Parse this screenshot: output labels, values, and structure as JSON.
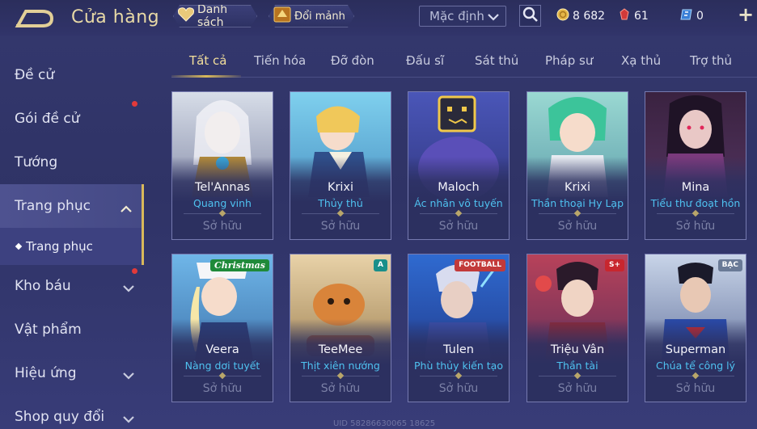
{
  "header": {
    "title": "Cửa hàng",
    "list_label": "Danh sách",
    "shards_label": "Đổi mảnh",
    "sort_value": "Mặc định"
  },
  "currencies": {
    "gold": "8 682",
    "ruby": "61",
    "voucher": "0"
  },
  "sidebar": {
    "items": [
      {
        "label": "Đề cử"
      },
      {
        "label": "Gói đề cử"
      },
      {
        "label": "Tướng"
      },
      {
        "label": "Trang phục"
      },
      {
        "label": "Trang phục"
      },
      {
        "label": "Kho báu"
      },
      {
        "label": "Vật phẩm"
      },
      {
        "label": "Hiệu ứng"
      },
      {
        "label": "Shop quy đổi"
      }
    ]
  },
  "tabs": [
    {
      "label": "Tất cả"
    },
    {
      "label": "Tiến hóa"
    },
    {
      "label": "Đỡ đòn"
    },
    {
      "label": "Đấu sĩ"
    },
    {
      "label": "Sát thủ"
    },
    {
      "label": "Pháp sư"
    },
    {
      "label": "Xạ thủ"
    },
    {
      "label": "Trợ thủ"
    }
  ],
  "owned_label": "Sở hữu",
  "cards": [
    {
      "hero": "Tel'Annas",
      "skin": "Quang vinh"
    },
    {
      "hero": "Krixi",
      "skin": "Thủy thủ"
    },
    {
      "hero": "Maloch",
      "skin": "Ác nhân vô tuyến"
    },
    {
      "hero": "Krixi",
      "skin": "Thần thoại Hy Lạp"
    },
    {
      "hero": "Mina",
      "skin": "Tiểu thư đoạt hồn"
    },
    {
      "hero": "Veera",
      "skin": "Nàng dơi tuyết",
      "badge": "Christmas"
    },
    {
      "hero": "TeeMee",
      "skin": "Thịt xiên nướng",
      "badge": "A"
    },
    {
      "hero": "Tulen",
      "skin": "Phù thủy kiến tạo",
      "badge": "FOOTBALL"
    },
    {
      "hero": "Triệu Vân",
      "skin": "Thần tài",
      "badge": "S+"
    },
    {
      "hero": "Superman",
      "skin": "Chúa tể công lý",
      "badge": "BẠC"
    }
  ],
  "footer": {
    "uid": "UID 58286630065 18625"
  },
  "colors": {
    "accent_gold": "#d9b95a",
    "skin_name": "#4fc2f0",
    "notification": "#e23a3a"
  }
}
